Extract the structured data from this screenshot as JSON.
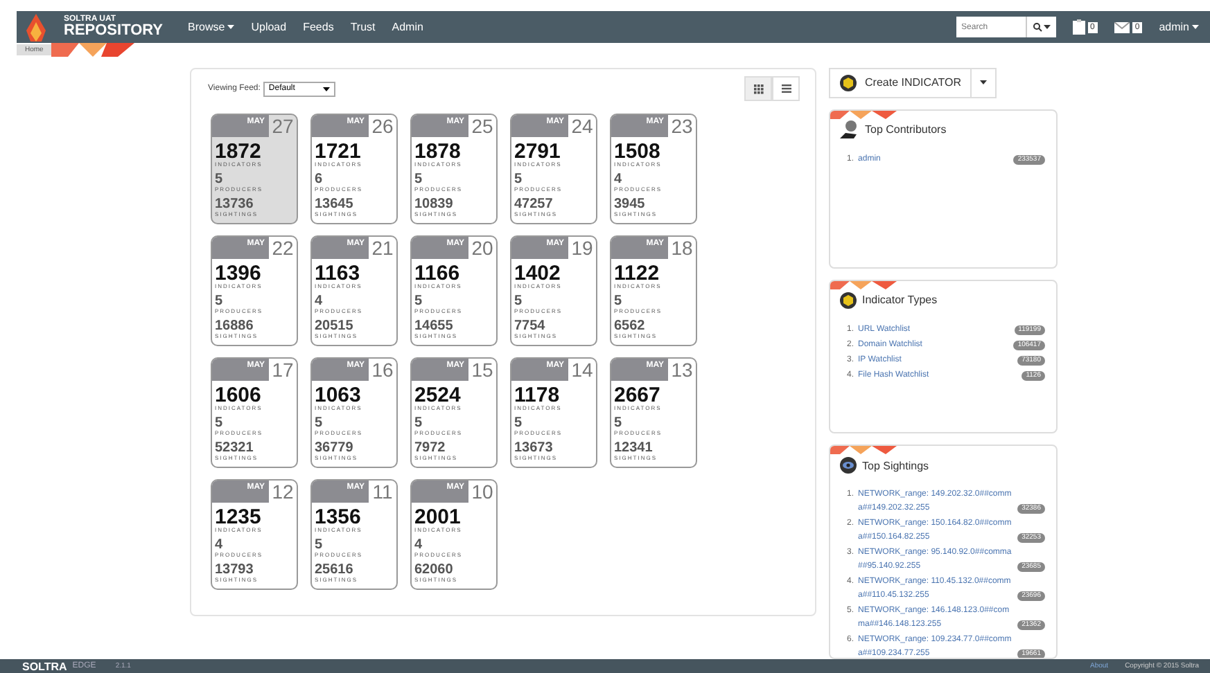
{
  "navbar": {
    "brand_top": "SOLTRA UAT",
    "brand": "REPOSITORY",
    "menu": [
      {
        "label": "Browse",
        "dropdown": true
      },
      {
        "label": "Upload",
        "dropdown": false
      },
      {
        "label": "Feeds",
        "dropdown": false
      },
      {
        "label": "Trust",
        "dropdown": false
      },
      {
        "label": "Admin",
        "dropdown": false
      }
    ],
    "search": {
      "placeholder": "Search"
    },
    "tasks_count": "0",
    "messages_count": "0",
    "user": "admin"
  },
  "breadcrumb": [
    "Home"
  ],
  "feed": {
    "label": "Viewing Feed:",
    "value": "Default",
    "views": [
      {
        "kind": "grid",
        "selected": true
      },
      {
        "kind": "list",
        "selected": false
      }
    ]
  },
  "cards": [
    {
      "month": "MAY",
      "day": "27",
      "selected": true,
      "stats": [
        {
          "value": "1872",
          "label": "INDICATORS"
        },
        {
          "value": "5",
          "label": "PRODUCERS"
        },
        {
          "value": "13736",
          "label": "SIGHTINGS"
        }
      ]
    },
    {
      "month": "MAY",
      "day": "26",
      "selected": false,
      "stats": [
        {
          "value": "1721",
          "label": "INDICATORS"
        },
        {
          "value": "6",
          "label": "PRODUCERS"
        },
        {
          "value": "13645",
          "label": "SIGHTINGS"
        }
      ]
    },
    {
      "month": "MAY",
      "day": "25",
      "selected": false,
      "stats": [
        {
          "value": "1878",
          "label": "INDICATORS"
        },
        {
          "value": "5",
          "label": "PRODUCERS"
        },
        {
          "value": "10839",
          "label": "SIGHTINGS"
        }
      ]
    },
    {
      "month": "MAY",
      "day": "24",
      "selected": false,
      "stats": [
        {
          "value": "2791",
          "label": "INDICATORS"
        },
        {
          "value": "5",
          "label": "PRODUCERS"
        },
        {
          "value": "47257",
          "label": "SIGHTINGS"
        }
      ]
    },
    {
      "month": "MAY",
      "day": "23",
      "selected": false,
      "stats": [
        {
          "value": "1508",
          "label": "INDICATORS"
        },
        {
          "value": "4",
          "label": "PRODUCERS"
        },
        {
          "value": "3945",
          "label": "SIGHTINGS"
        }
      ]
    },
    {
      "month": "MAY",
      "day": "22",
      "selected": false,
      "stats": [
        {
          "value": "1396",
          "label": "INDICATORS"
        },
        {
          "value": "5",
          "label": "PRODUCERS"
        },
        {
          "value": "16886",
          "label": "SIGHTINGS"
        }
      ]
    },
    {
      "month": "MAY",
      "day": "21",
      "selected": false,
      "stats": [
        {
          "value": "1163",
          "label": "INDICATORS"
        },
        {
          "value": "4",
          "label": "PRODUCERS"
        },
        {
          "value": "20515",
          "label": "SIGHTINGS"
        }
      ]
    },
    {
      "month": "MAY",
      "day": "20",
      "selected": false,
      "stats": [
        {
          "value": "1166",
          "label": "INDICATORS"
        },
        {
          "value": "5",
          "label": "PRODUCERS"
        },
        {
          "value": "14655",
          "label": "SIGHTINGS"
        }
      ]
    },
    {
      "month": "MAY",
      "day": "19",
      "selected": false,
      "stats": [
        {
          "value": "1402",
          "label": "INDICATORS"
        },
        {
          "value": "5",
          "label": "PRODUCERS"
        },
        {
          "value": "7754",
          "label": "SIGHTINGS"
        }
      ]
    },
    {
      "month": "MAY",
      "day": "18",
      "selected": false,
      "stats": [
        {
          "value": "1122",
          "label": "INDICATORS"
        },
        {
          "value": "5",
          "label": "PRODUCERS"
        },
        {
          "value": "6562",
          "label": "SIGHTINGS"
        }
      ]
    },
    {
      "month": "MAY",
      "day": "17",
      "selected": false,
      "stats": [
        {
          "value": "1606",
          "label": "INDICATORS"
        },
        {
          "value": "5",
          "label": "PRODUCERS"
        },
        {
          "value": "52321",
          "label": "SIGHTINGS"
        }
      ]
    },
    {
      "month": "MAY",
      "day": "16",
      "selected": false,
      "stats": [
        {
          "value": "1063",
          "label": "INDICATORS"
        },
        {
          "value": "5",
          "label": "PRODUCERS"
        },
        {
          "value": "36779",
          "label": "SIGHTINGS"
        }
      ]
    },
    {
      "month": "MAY",
      "day": "15",
      "selected": false,
      "stats": [
        {
          "value": "2524",
          "label": "INDICATORS"
        },
        {
          "value": "5",
          "label": "PRODUCERS"
        },
        {
          "value": "7972",
          "label": "SIGHTINGS"
        }
      ]
    },
    {
      "month": "MAY",
      "day": "14",
      "selected": false,
      "stats": [
        {
          "value": "1178",
          "label": "INDICATORS"
        },
        {
          "value": "5",
          "label": "PRODUCERS"
        },
        {
          "value": "13673",
          "label": "SIGHTINGS"
        }
      ]
    },
    {
      "month": "MAY",
      "day": "13",
      "selected": false,
      "stats": [
        {
          "value": "2667",
          "label": "INDICATORS"
        },
        {
          "value": "5",
          "label": "PRODUCERS"
        },
        {
          "value": "12341",
          "label": "SIGHTINGS"
        }
      ]
    },
    {
      "month": "MAY",
      "day": "12",
      "selected": false,
      "stats": [
        {
          "value": "1235",
          "label": "INDICATORS"
        },
        {
          "value": "4",
          "label": "PRODUCERS"
        },
        {
          "value": "13793",
          "label": "SIGHTINGS"
        }
      ]
    },
    {
      "month": "MAY",
      "day": "11",
      "selected": false,
      "stats": [
        {
          "value": "1356",
          "label": "INDICATORS"
        },
        {
          "value": "5",
          "label": "PRODUCERS"
        },
        {
          "value": "25616",
          "label": "SIGHTINGS"
        }
      ]
    },
    {
      "month": "MAY",
      "day": "10",
      "selected": false,
      "stats": [
        {
          "value": "2001",
          "label": "INDICATORS"
        },
        {
          "value": "4",
          "label": "PRODUCERS"
        },
        {
          "value": "62060",
          "label": "SIGHTINGS"
        }
      ]
    }
  ],
  "create_button": "Create INDICATOR",
  "widgets": [
    {
      "kind": "contributors",
      "title": "Top Contributors",
      "items": [
        {
          "number": "1.",
          "label": "admin",
          "count": "233537"
        }
      ]
    },
    {
      "kind": "types",
      "title": "Indicator Types",
      "items": [
        {
          "number": "1.",
          "label": "URL Watchlist",
          "count": "119199"
        },
        {
          "number": "2.",
          "label": "Domain Watchlist",
          "count": "106417"
        },
        {
          "number": "3.",
          "label": "IP Watchlist",
          "count": "73180"
        },
        {
          "number": "4.",
          "label": "File Hash Watchlist",
          "count": "1126"
        }
      ]
    },
    {
      "kind": "sightings",
      "title": "Top Sightings",
      "items": [
        {
          "number": "1.",
          "label": "NETWORK_range: 149.202.32.0##comma##149.202.32.255",
          "count": "32386"
        },
        {
          "number": "2.",
          "label": "NETWORK_range: 150.164.82.0##comma##150.164.82.255",
          "count": "32253"
        },
        {
          "number": "3.",
          "label": "NETWORK_range: 95.140.92.0##comma##95.140.92.255",
          "count": "23685"
        },
        {
          "number": "4.",
          "label": "NETWORK_range: 110.45.132.0##comma##110.45.132.255",
          "count": "23696"
        },
        {
          "number": "5.",
          "label": "NETWORK_range: 146.148.123.0##comma##146.148.123.255",
          "count": "21362"
        },
        {
          "number": "6.",
          "label": "NETWORK_range: 109.234.77.0##comma##109.234.77.255",
          "count": "19661"
        }
      ]
    }
  ],
  "footer": {
    "brand": "SOLTRA",
    "brand_suffix": "EDGE",
    "version": "2.1.1",
    "about": "About",
    "copyright": "Copyright © 2015 Soltra"
  }
}
